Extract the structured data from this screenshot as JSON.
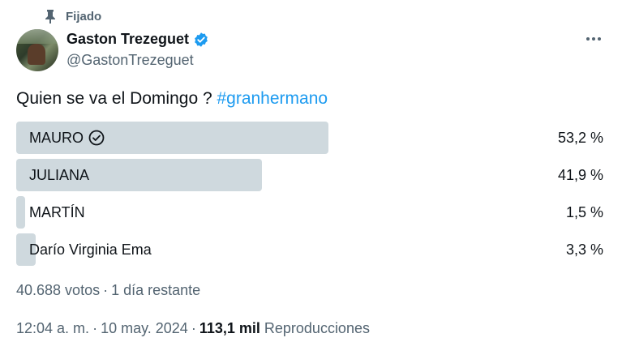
{
  "pinned": {
    "label": "Fijado",
    "icon": "pin-icon"
  },
  "author": {
    "name": "Gaston Trezeguet",
    "handle": "@GastonTrezeguet",
    "verified_icon": "verified-badge-icon",
    "badge_color": "#1d9bf0"
  },
  "menu": {
    "icon": "more-options-icon"
  },
  "tweet": {
    "text": "Quien se va el Domingo ? ",
    "hashtag": "#granhermano"
  },
  "poll": {
    "options": [
      {
        "label": "MAURO",
        "percent_text": "53,2 %",
        "percent": 53.2,
        "winner": true
      },
      {
        "label": "JULIANA",
        "percent_text": "41,9 %",
        "percent": 41.9,
        "winner": false
      },
      {
        "label": "MARTÍN",
        "percent_text": "1,5 %",
        "percent": 1.5,
        "winner": false
      },
      {
        "label": "Darío Virginia Ema",
        "percent_text": "3,3 %",
        "percent": 3.3,
        "winner": false
      }
    ],
    "votes": "40.688 votos",
    "separator": "·",
    "remaining": "1 día restante",
    "bar_color": "#cfd9de"
  },
  "footer": {
    "time": "12:04 a. m.",
    "separator": "·",
    "date": "10 may. 2024",
    "views": "113,1 mil",
    "views_label": "Reproducciones"
  }
}
